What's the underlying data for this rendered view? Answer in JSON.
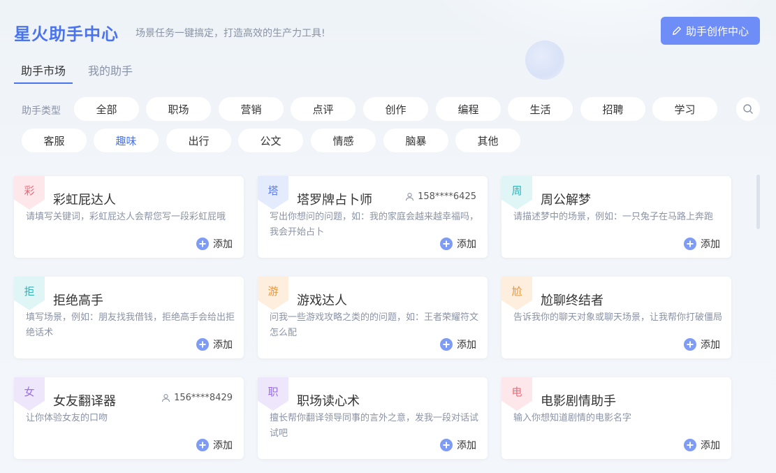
{
  "header": {
    "title": "星火助手中心",
    "subtitle": "场景任务一键搞定，打造高效的生产力工具!",
    "create_button": "助手创作中心"
  },
  "tabs": [
    {
      "label": "助手市场",
      "active": true
    },
    {
      "label": "我的助手",
      "active": false
    }
  ],
  "filter": {
    "label": "助手类型",
    "row1": [
      "全部",
      "职场",
      "营销",
      "点评",
      "创作",
      "编程",
      "生活",
      "招聘",
      "学习"
    ],
    "row2": [
      "客服",
      "趣味",
      "出行",
      "公文",
      "情感",
      "脑暴",
      "其他"
    ],
    "selected": "趣味",
    "search_icon": "search-icon"
  },
  "cards": [
    {
      "badge": "彩",
      "title": "彩虹屁达人",
      "user": "",
      "desc": "请填写关键词，彩虹屁达人会帮您写一段彩虹屁哦",
      "add": "添加",
      "badge_bg": "#fde7ea",
      "badge_fg": "#e86a78"
    },
    {
      "badge": "塔",
      "title": "塔罗牌占卜师",
      "user": "158****6425",
      "desc": "写出你想问的问题，如：我的家庭会越来越幸福吗，我会开始占卜",
      "add": "添加",
      "badge_bg": "#e3ebfd",
      "badge_fg": "#5b7ef0"
    },
    {
      "badge": "周",
      "title": "周公解梦",
      "user": "",
      "desc": "请描述梦中的场景，例如：一只兔子在马路上奔跑",
      "add": "添加",
      "badge_bg": "#dff5f6",
      "badge_fg": "#2eb3bc"
    },
    {
      "badge": "拒",
      "title": "拒绝高手",
      "user": "",
      "desc": "填写场景，例如：朋友找我借钱，拒绝高手会给出拒绝话术",
      "add": "添加",
      "badge_bg": "#dff5f6",
      "badge_fg": "#2eb3bc"
    },
    {
      "badge": "游",
      "title": "游戏达人",
      "user": "",
      "desc": "问我一些游戏攻略之类的的问题，如：王者荣耀符文怎么配",
      "add": "添加",
      "badge_bg": "#fdeedd",
      "badge_fg": "#f0963a"
    },
    {
      "badge": "尬",
      "title": "尬聊终结者",
      "user": "",
      "desc": "告诉我你的聊天对象或聊天场景，让我帮你打破僵局",
      "add": "添加",
      "badge_bg": "#fdeedd",
      "badge_fg": "#f0963a"
    },
    {
      "badge": "女",
      "title": "女友翻译器",
      "user": "156****8429",
      "desc": "让你体验女友的口吻",
      "add": "添加",
      "badge_bg": "#eee6fb",
      "badge_fg": "#9b6fe6"
    },
    {
      "badge": "职",
      "title": "职场读心术",
      "user": "",
      "desc": "擅长帮你翻译领导同事的言外之意，发我一段对话试试吧",
      "add": "添加",
      "badge_bg": "#eee6fb",
      "badge_fg": "#9b6fe6"
    },
    {
      "badge": "电",
      "title": "电影剧情助手",
      "user": "",
      "desc": "输入你想知道剧情的电影名字",
      "add": "添加",
      "badge_bg": "#fde7ea",
      "badge_fg": "#e86a78"
    }
  ]
}
